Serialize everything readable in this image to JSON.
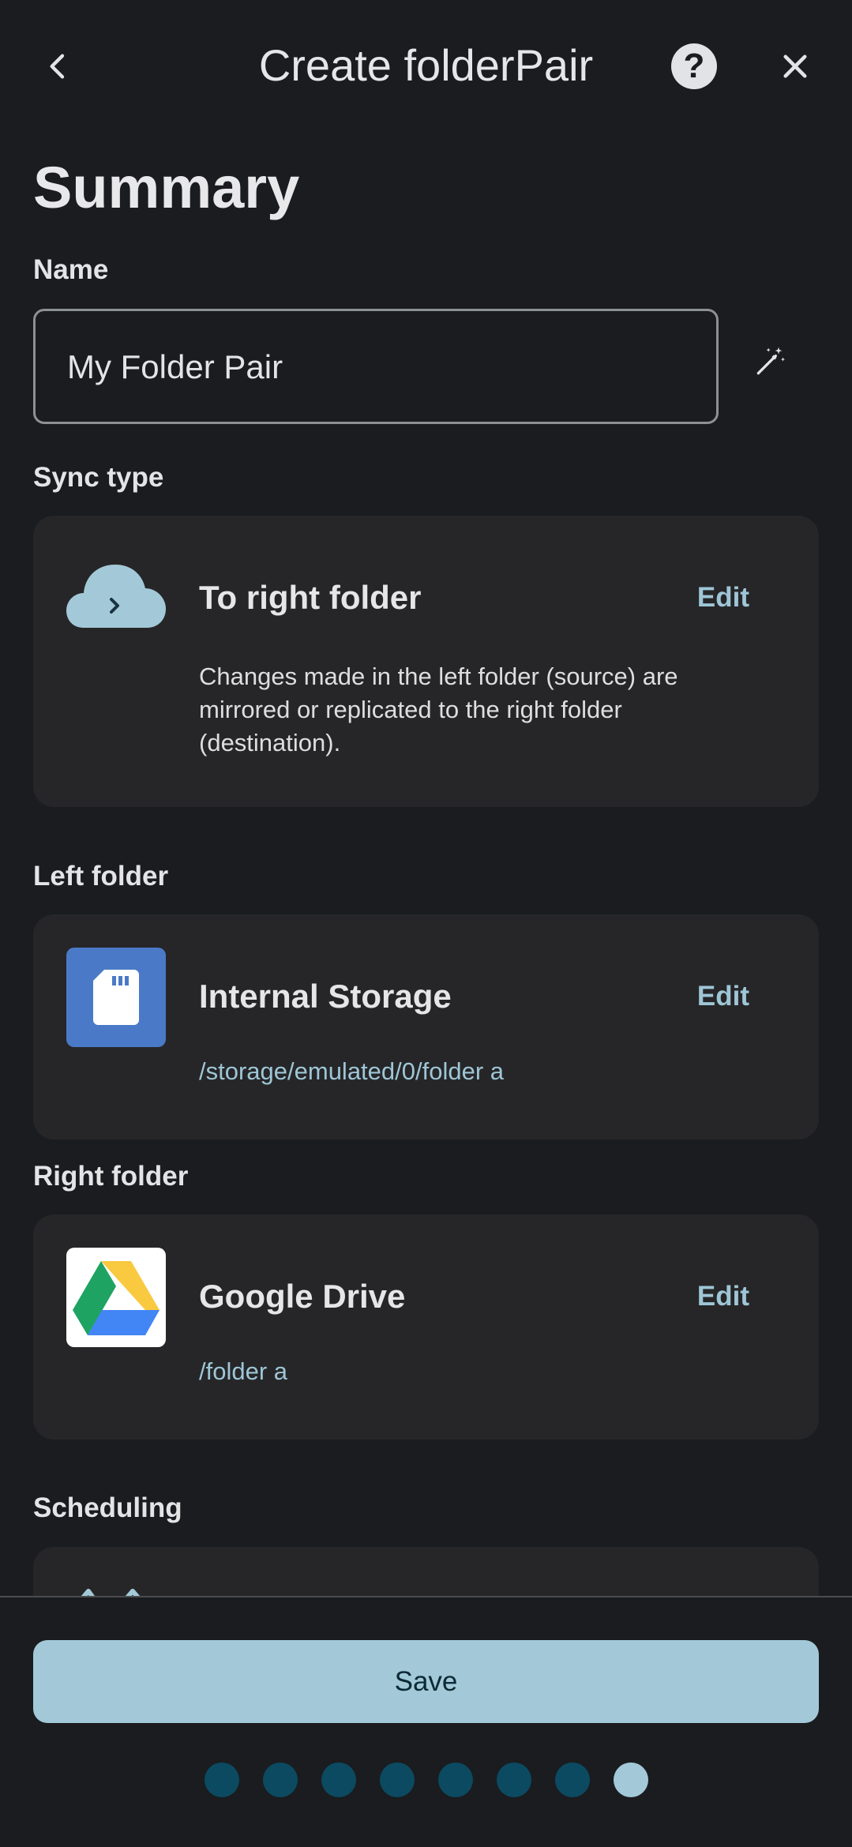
{
  "header": {
    "title": "Create folderPair"
  },
  "summary": {
    "heading": "Summary",
    "name_label": "Name",
    "name_value": "My Folder Pair",
    "sync_type_label": "Sync type",
    "sync_type": {
      "title": "To right folder",
      "edit": "Edit",
      "description": "Changes made in the left folder (source) are mirrored or replicated to the right folder (destination)."
    },
    "left_folder_label": "Left folder",
    "left_folder": {
      "title": "Internal Storage",
      "edit": "Edit",
      "path": "/storage/emulated/0/folder a"
    },
    "right_folder_label": "Right folder",
    "right_folder": {
      "title": "Google Drive",
      "edit": "Edit",
      "path": "/folder a"
    },
    "scheduling_label": "Scheduling"
  },
  "footer": {
    "save_label": "Save",
    "steps_total": 8,
    "steps_current": 8
  },
  "colors": {
    "background": "#1a1c1f",
    "card": "#262628",
    "accent": "#9ec6d6",
    "save_button": "#a3c9d8",
    "dot_inactive": "#0b4a61"
  },
  "icons": {
    "back": "chevron-left-icon",
    "help": "help-circle-icon",
    "close": "close-icon",
    "wand": "magic-wand-icon",
    "sync": "cloud-arrow-right-icon",
    "storage": "sd-card-icon",
    "drive": "google-drive-icon"
  }
}
